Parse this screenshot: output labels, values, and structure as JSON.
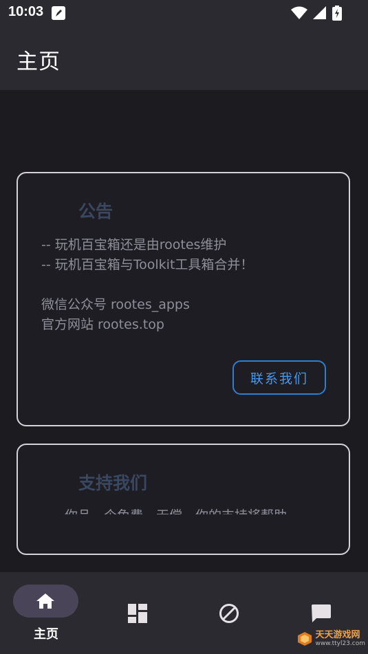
{
  "status_bar": {
    "time": "10:03"
  },
  "app_bar": {
    "title": "主页"
  },
  "notice_card": {
    "title": "公告",
    "lines": [
      "-- 玩机百宝箱还是由rootes维护",
      "-- 玩机百宝箱与Toolkit工具箱合并！",
      "微信公众号 rootes_apps",
      "官方网站 rootes.top"
    ],
    "contact_button": "联系我们"
  },
  "support_card": {
    "title": "支持我们",
    "faded_text": "你品一个免费，无偿，你的支持将帮助"
  },
  "bottom_nav": {
    "items": [
      {
        "label": "主页",
        "icon": "home-icon",
        "selected": true
      },
      {
        "label": "",
        "icon": "dashboard-icon",
        "selected": false
      },
      {
        "label": "",
        "icon": "block-icon",
        "selected": false
      },
      {
        "label": "",
        "icon": "message-icon",
        "selected": false
      }
    ]
  },
  "watermark": {
    "brand": "天天游戏网",
    "url": "www.ttyl23.com"
  },
  "colors": {
    "background": "#1c1b20",
    "bar": "#2b2a30",
    "accent_blue": "#4d97e6",
    "nav_pill": "#4a4458"
  }
}
